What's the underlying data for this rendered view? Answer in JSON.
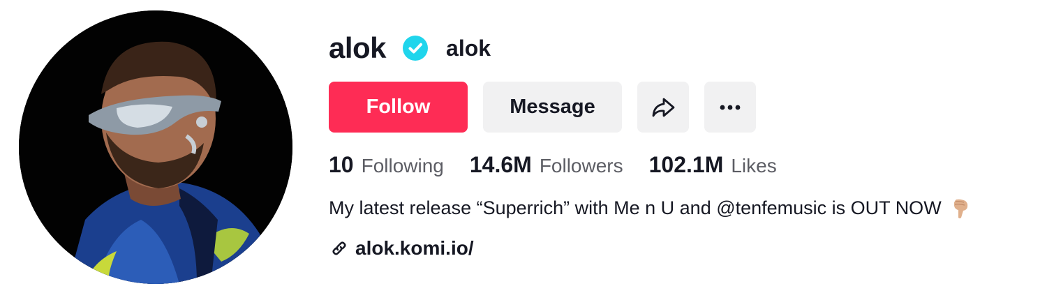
{
  "profile": {
    "username": "alok",
    "nickname": "alok",
    "verified": true,
    "avatar_icon": "profile-photo",
    "colors": {
      "follow_bg": "#fe2c55",
      "secondary_bg": "#f1f1f2",
      "verified_badge": "#20d5ec",
      "text_primary": "#161823",
      "text_secondary": "#5c5d64"
    }
  },
  "actions": {
    "follow_label": "Follow",
    "message_label": "Message",
    "share_icon": "share-arrow-icon",
    "more_icon": "more-dots-icon"
  },
  "stats": {
    "following": {
      "value": "10",
      "label": "Following"
    },
    "followers": {
      "value": "14.6M",
      "label": "Followers"
    },
    "likes": {
      "value": "102.1M",
      "label": "Likes"
    }
  },
  "bio": {
    "text": "My latest release “Superrich” with Me n U and @tenfemusic is OUT NOW",
    "emoji_icon": "pointing-down-hand"
  },
  "link": {
    "icon": "link-icon",
    "text": "alok.komi.io/"
  }
}
